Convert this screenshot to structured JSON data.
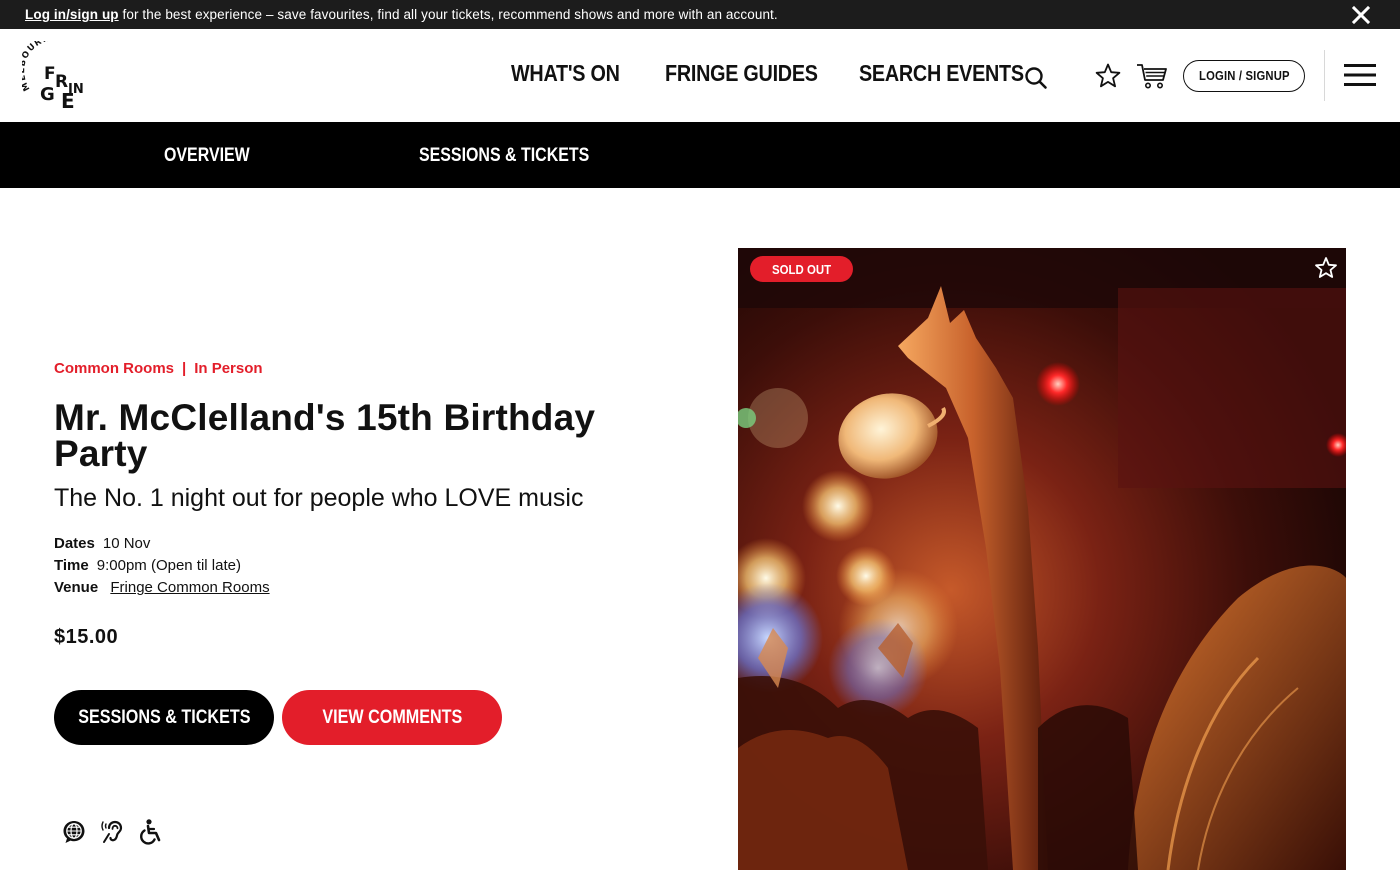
{
  "announcement": {
    "link_text": "Log in/sign up",
    "text": " for the best experience – save favourites, find all your tickets, recommend shows and more with an account."
  },
  "header": {
    "logo_name": "Melbourne Fringe",
    "logo_top_text": "MELBOURNE",
    "logo_letters": [
      "F",
      "R",
      "IN",
      "G",
      "E"
    ],
    "nav": [
      "WHAT'S ON",
      "FRINGE GUIDES",
      "SEARCH EVENTS"
    ],
    "login_label": "LOGIN / SIGNUP",
    "icons": [
      "search-icon",
      "star-icon",
      "cart-icon",
      "hamburger-menu-icon"
    ]
  },
  "subnav": [
    "OVERVIEW",
    "SESSIONS & TICKETS"
  ],
  "event": {
    "venue_tag": "Common Rooms",
    "separator": "|",
    "format_tag": "In Person",
    "title": "Mr. McClelland's 15th Birthday Party",
    "tagline": "The No. 1 night out for people who LOVE music",
    "dates_label": "Dates",
    "dates_value": "10 Nov",
    "time_label": "Time",
    "time_value": "9:00pm (Open til late)",
    "venue_label": "Venue",
    "venue_value": "Fringe Common Rooms",
    "price": "$15.00",
    "sessions_button": "SESSIONS & TICKETS",
    "comments_button": "VIEW COMMENTS",
    "accessibility_icons": [
      "language-globe-icon",
      "hearing-icon",
      "wheelchair-icon"
    ]
  },
  "image": {
    "badge": "SOLD OUT",
    "alt": "Crowd with raised hands at a concert under red stage lights"
  },
  "colors": {
    "accent_red": "#e31e2a",
    "dark": "#000000",
    "topbar": "#1c1c1c"
  }
}
